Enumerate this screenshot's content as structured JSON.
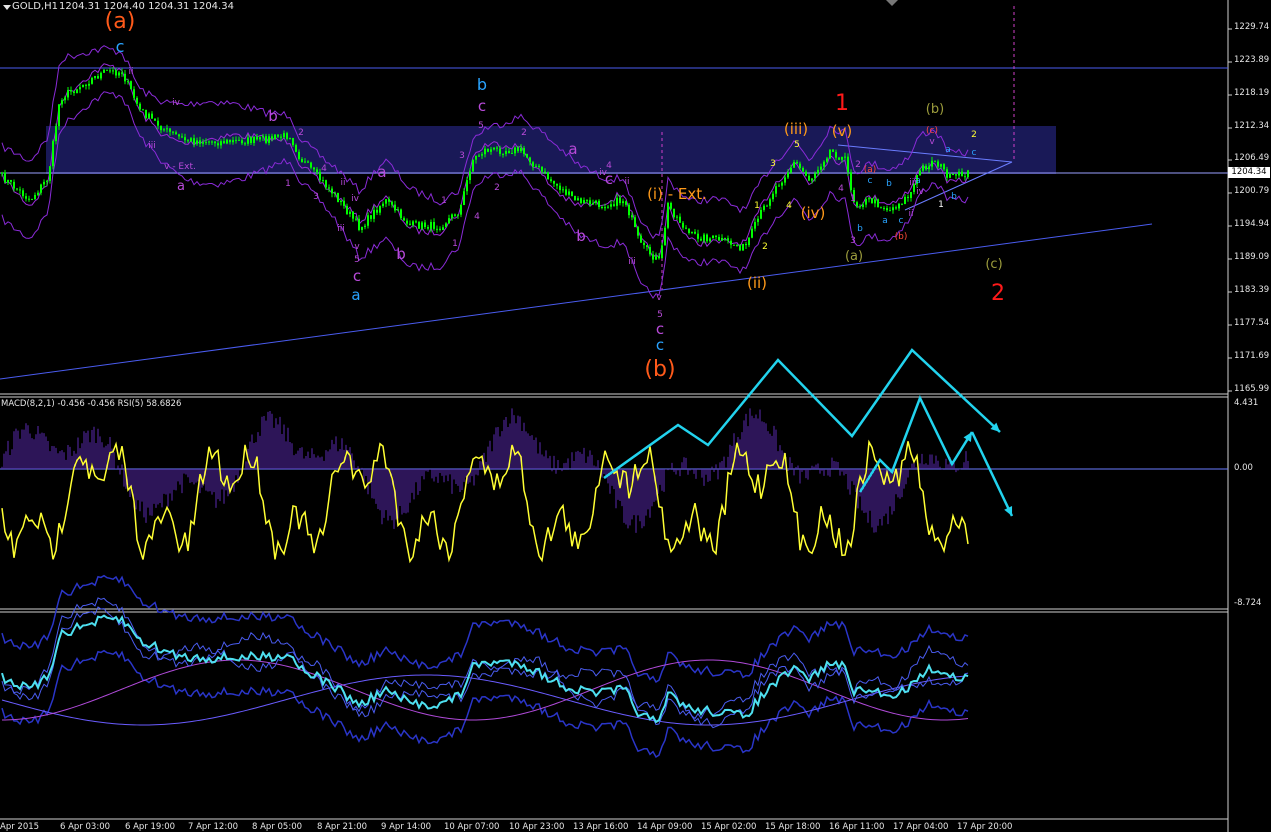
{
  "header": {
    "symbol": "GOLD,H1",
    "ohlc": "1204.31 1204.40 1204.31 1204.34",
    "indicator": "MACD(8,2,1) -0.456 -0.456  RSI(5) 58.6826"
  },
  "price_axis": [
    "1229.74",
    "1223.89",
    "1218.19",
    "1212.34",
    "1206.49",
    "1200.79",
    "1194.94",
    "1189.09",
    "1183.39",
    "1177.54",
    "1171.69",
    "1165.99"
  ],
  "current_price": "1204.34",
  "macd_axis": {
    "top": "4.431",
    "zero": "0.00",
    "bottom": "-8.724"
  },
  "time_axis": [
    "Apr 2015",
    "6 Apr 03:00",
    "6 Apr 19:00",
    "7 Apr 12:00",
    "8 Apr 05:00",
    "8 Apr 21:00",
    "9 Apr 14:00",
    "10 Apr 07:00",
    "10 Apr 23:00",
    "13 Apr 16:00",
    "14 Apr 09:00",
    "15 Apr 02:00",
    "15 Apr 18:00",
    "16 Apr 11:00",
    "17 Apr 04:00",
    "17 Apr 20:00"
  ],
  "colors": {
    "background": "#000000",
    "candle": "#00ff00",
    "box": "#1a1a5c",
    "line": "#4a5cf0",
    "envelope": "#8a2bd8",
    "macd_hist": "#5a2ab0",
    "rsi": "#ffff33",
    "arrow": "#22d3ee",
    "osc": "#4ee0f0"
  },
  "wave_labels": [
    {
      "text": "(a)",
      "color": "#ff5a1a"
    },
    {
      "text": "c",
      "color": "#29a3ff"
    },
    {
      "text": "ii",
      "color": "#b84ad9"
    },
    {
      "text": "iv",
      "color": "#b84ad9"
    },
    {
      "text": "iii",
      "color": "#b84ad9"
    },
    {
      "text": "v - Ext.",
      "color": "#b84ad9"
    },
    {
      "text": "a",
      "color": "#b84ad9"
    },
    {
      "text": "b",
      "color": "#b84ad9"
    },
    {
      "text": "2",
      "color": "#b84ad9"
    },
    {
      "text": "1",
      "color": "#b84ad9"
    },
    {
      "text": "4",
      "color": "#b84ad9"
    },
    {
      "text": "3",
      "color": "#b84ad9"
    },
    {
      "text": "ii",
      "color": "#b84ad9"
    },
    {
      "text": "iv",
      "color": "#b84ad9"
    },
    {
      "text": "iii",
      "color": "#b84ad9"
    },
    {
      "text": "v",
      "color": "#b84ad9"
    },
    {
      "text": "5",
      "color": "#b84ad9"
    },
    {
      "text": "c",
      "color": "#b84ad9"
    },
    {
      "text": "a",
      "color": "#29a3ff"
    },
    {
      "text": "a",
      "color": "#b84ad9"
    },
    {
      "text": "b",
      "color": "#b84ad9"
    },
    {
      "text": "b",
      "color": "#29a3ff"
    },
    {
      "text": "c",
      "color": "#b84ad9"
    },
    {
      "text": "5",
      "color": "#b84ad9"
    },
    {
      "text": "3",
      "color": "#b84ad9"
    },
    {
      "text": "4",
      "color": "#b84ad9"
    },
    {
      "text": "1",
      "color": "#b84ad9"
    },
    {
      "text": "2",
      "color": "#b84ad9"
    },
    {
      "text": "1",
      "color": "#b84ad9"
    },
    {
      "text": "2",
      "color": "#b84ad9"
    },
    {
      "text": "a",
      "color": "#b84ad9"
    },
    {
      "text": "4",
      "color": "#b84ad9"
    },
    {
      "text": "c",
      "color": "#b84ad9"
    },
    {
      "text": "b",
      "color": "#b84ad9"
    },
    {
      "text": "ii",
      "color": "#b84ad9"
    },
    {
      "text": "(i) - Ext.",
      "color": "#ff9a1a"
    },
    {
      "text": "iv",
      "color": "#b84ad9"
    },
    {
      "text": "iii",
      "color": "#b84ad9"
    },
    {
      "text": "v",
      "color": "#b84ad9"
    },
    {
      "text": "5",
      "color": "#b84ad9"
    },
    {
      "text": "c",
      "color": "#b84ad9"
    },
    {
      "text": "c",
      "color": "#29a3ff"
    },
    {
      "text": "(b)",
      "color": "#ff5a1a"
    },
    {
      "text": "1",
      "color": "#ffff33"
    },
    {
      "text": "2",
      "color": "#ffff33"
    },
    {
      "text": "(ii)",
      "color": "#ff9a1a"
    },
    {
      "text": "3",
      "color": "#ffff33"
    },
    {
      "text": "5",
      "color": "#ffff33"
    },
    {
      "text": "4",
      "color": "#ffff33"
    },
    {
      "text": "(iii)",
      "color": "#ff9a1a"
    },
    {
      "text": "(iv)",
      "color": "#ff9a1a"
    },
    {
      "text": "(v)",
      "color": "#ff9a1a"
    },
    {
      "text": "1",
      "color": "#ff1a1a"
    },
    {
      "text": "2",
      "color": "#b84ad9"
    },
    {
      "text": "(a)",
      "color": "#ff4a3a"
    },
    {
      "text": "c",
      "color": "#29a3ff"
    },
    {
      "text": "b",
      "color": "#29a3ff"
    },
    {
      "text": "4",
      "color": "#b84ad9"
    },
    {
      "text": "1",
      "color": "#b84ad9"
    },
    {
      "text": "3",
      "color": "#b84ad9"
    },
    {
      "text": "b",
      "color": "#29a3ff"
    },
    {
      "text": "a",
      "color": "#29a3ff"
    },
    {
      "text": "c",
      "color": "#29a3ff"
    },
    {
      "text": "(b)",
      "color": "#ff4a3a"
    },
    {
      "text": "(a)",
      "color": "#9c9c3c"
    },
    {
      "text": "a",
      "color": "#29a3ff"
    },
    {
      "text": "ii",
      "color": "#b84ad9"
    },
    {
      "text": "iii",
      "color": "#b84ad9"
    },
    {
      "text": "iv",
      "color": "#b84ad9"
    },
    {
      "text": "v",
      "color": "#b84ad9"
    },
    {
      "text": "(c)",
      "color": "#ff4a3a"
    },
    {
      "text": "(b)",
      "color": "#9c9c3c"
    },
    {
      "text": "a",
      "color": "#29a3ff"
    },
    {
      "text": "c",
      "color": "#29a3ff"
    },
    {
      "text": "b",
      "color": "#29a3ff"
    },
    {
      "text": "1",
      "color": "#ffffff"
    },
    {
      "text": "2",
      "color": "#ffff33"
    },
    {
      "text": "(c)",
      "color": "#9c9c3c"
    },
    {
      "text": "2",
      "color": "#ff1a1a"
    }
  ]
}
